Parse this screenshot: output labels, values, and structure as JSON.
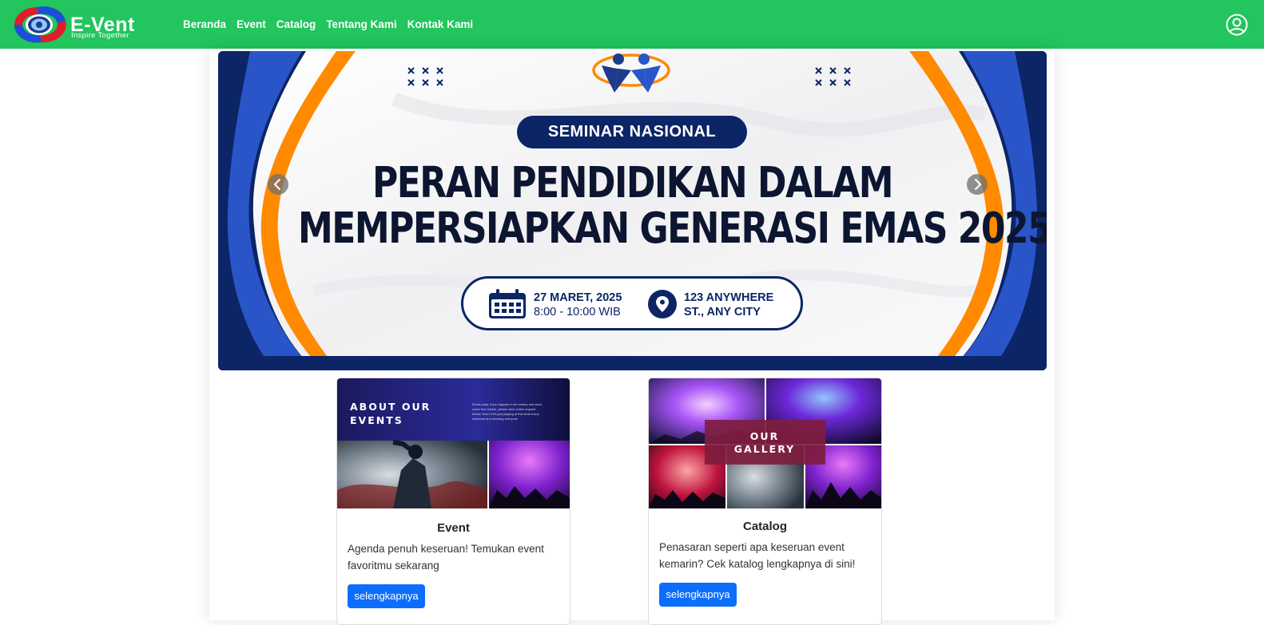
{
  "brand": {
    "name": "E-Vent",
    "tagline": "Inspire Together"
  },
  "nav": [
    {
      "label": "Beranda"
    },
    {
      "label": "Event"
    },
    {
      "label": "Catalog"
    },
    {
      "label": "Tentang Kami"
    },
    {
      "label": "Kontak Kami"
    }
  ],
  "profile_icon": "user-circle-icon",
  "banner": {
    "badge": "SEMINAR NASIONAL",
    "headline_line1": "PERAN PENDIDIKAN DALAM",
    "headline_line2": "MEMPERSIAPKAN GENERASI EMAS 2025",
    "date": "27 MARET, 2025",
    "time": "8:00 - 10:00 WIB",
    "location_line1": "123 ANYWHERE",
    "location_line2": "ST., ANY CITY",
    "date_icon": "calendar-icon",
    "location_icon": "map-pin-icon",
    "prev_icon": "chevron-left-icon",
    "next_icon": "chevron-right-icon"
  },
  "cards": [
    {
      "image_title_line1": "ABOUT OUR",
      "image_title_line2": "EVENTS",
      "image_text_line1": "Event party, if you happen to be nearby and want",
      "image_text_line2": "come free tickets, please click online request",
      "image_text_line3": "below. Even if it's just playing at this level every",
      "image_text_line4": "weekend and showing everyone",
      "title": "Event",
      "text": "Agenda penuh keseruan! Temukan event favoritmu sekarang",
      "button": "selengkapnya"
    },
    {
      "image_title_line1": "OUR",
      "image_title_line2": "GALLERY",
      "title": "Catalog",
      "text": "Penasaran seperti apa keseruan event kemarin? Cek katalog lengkapnya di sini!",
      "button": "selengkapnya"
    }
  ],
  "colors": {
    "navbar": "#22c55e",
    "banner_navy": "#0b2566",
    "banner_orange": "#ff8a00",
    "button_blue": "#0d6efd"
  }
}
